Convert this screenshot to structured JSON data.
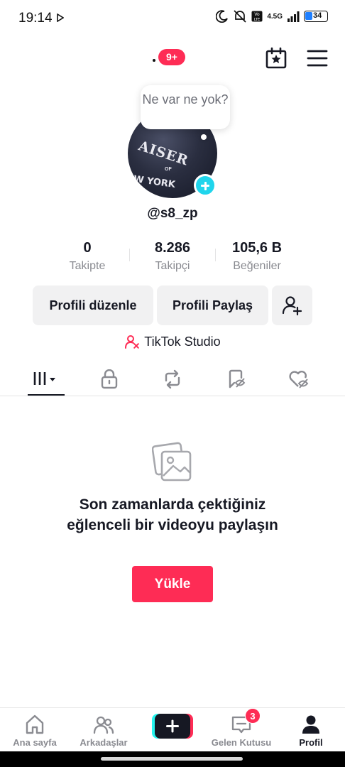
{
  "status_bar": {
    "time": "19:14",
    "network": "4.5G",
    "battery": "34"
  },
  "top_nav": {
    "notification_badge": "9+"
  },
  "profile": {
    "bubble_text": "Ne var ne yok?",
    "username": "@s8_zp",
    "avatar_text_1": "AISER",
    "avatar_text_of": "OF",
    "avatar_text_2": "W YORK"
  },
  "stats": [
    {
      "value": "0",
      "label": "Takipte"
    },
    {
      "value": "8.286",
      "label": "Takipçi"
    },
    {
      "value": "105,6 B",
      "label": "Beğeniler"
    }
  ],
  "actions": {
    "edit_profile": "Profili düzenle",
    "share_profile": "Profili Paylaş",
    "studio": "TikTok Studio"
  },
  "tabs": [
    "videos-grid-icon",
    "lock-icon",
    "repost-icon",
    "favorites-icon",
    "liked-icon"
  ],
  "empty_state": {
    "message": "Son zamanlarda çektiğiniz eğlenceli bir videoyu paylaşın",
    "upload_label": "Yükle"
  },
  "bottom_nav": {
    "home": "Ana sayfa",
    "friends": "Arkadaşlar",
    "inbox": "Gelen Kutusu",
    "inbox_badge": "3",
    "profile": "Profil"
  },
  "colors": {
    "accent": "#fe2c55",
    "cyan": "#20d5ec",
    "text": "#161823",
    "muted": "#8a8b91"
  }
}
